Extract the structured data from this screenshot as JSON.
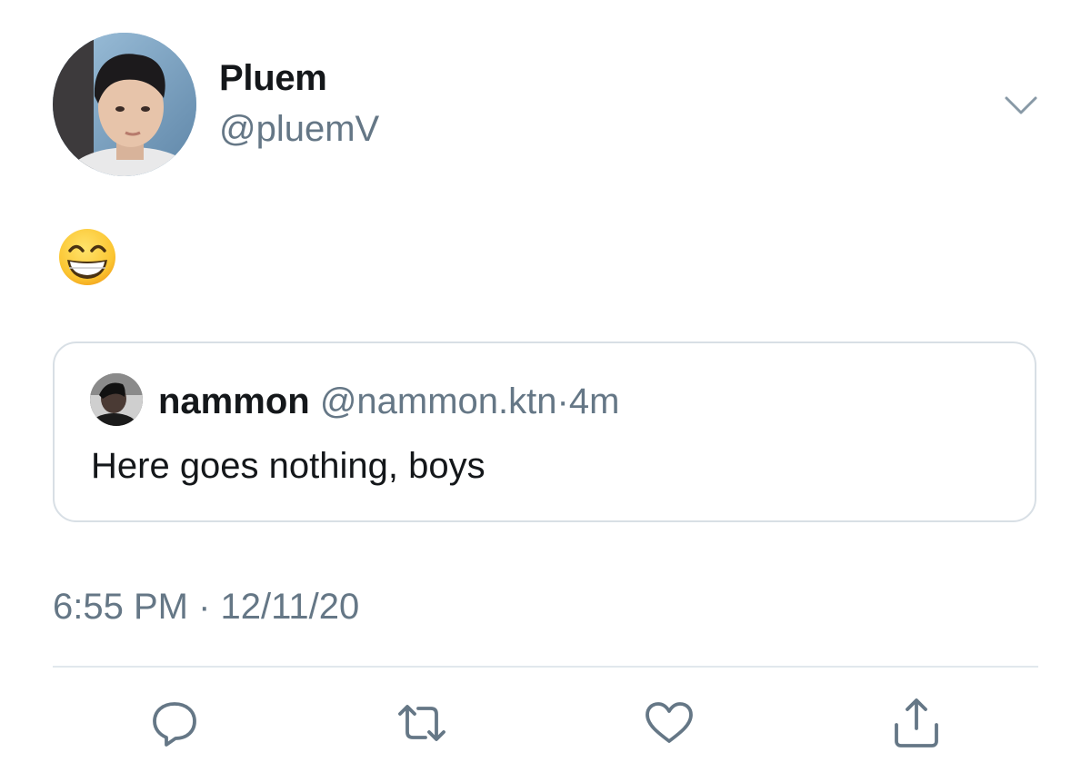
{
  "tweet": {
    "author": {
      "display_name": "Pluem",
      "handle": "@pluemV"
    },
    "text_emoji": "😁",
    "quoted": {
      "display_name": "nammon",
      "handle": "@nammon.ktn",
      "separator": "·",
      "time": "4m",
      "text": "Here goes nothing, boys"
    },
    "timestamp": "6:55 PM · 12/11/20"
  },
  "icons": {
    "more": "chevron-down-icon",
    "reply": "reply-icon",
    "retweet": "retweet-icon",
    "like": "heart-icon",
    "share": "share-icon"
  },
  "colors": {
    "text_primary": "#14171a",
    "text_secondary": "#657786",
    "border": "#d8dfe5",
    "icon": "#657786"
  }
}
